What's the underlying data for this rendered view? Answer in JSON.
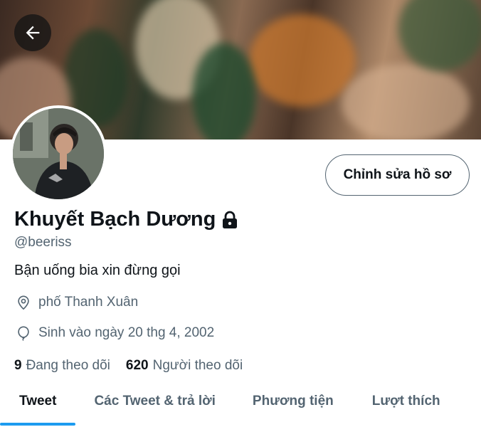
{
  "profile": {
    "display_name": "Khuyết Bạch Dương",
    "handle": "@beeriss",
    "bio": "Bận uống bia xin đừng gọi",
    "location": "phố Thanh Xuân",
    "birthday": "Sinh vào ngày 20 thg 4, 2002",
    "following_count": "9",
    "following_label": "Đang theo dõi",
    "followers_count": "620",
    "followers_label": "Người theo dõi"
  },
  "actions": {
    "edit_profile": "Chỉnh sửa hồ sơ"
  },
  "tabs": [
    {
      "label": "Tweet",
      "active": true
    },
    {
      "label": "Các Tweet & trả lời",
      "active": false
    },
    {
      "label": "Phương tiện",
      "active": false
    },
    {
      "label": "Lượt thích",
      "active": false
    }
  ],
  "icons": {
    "back": "arrow-left-icon",
    "lock": "lock-icon",
    "location": "location-pin-icon",
    "birthday": "balloon-icon"
  },
  "colors": {
    "accent": "#1d9bf0",
    "secondary_text": "#536471",
    "primary_text": "#0f1419"
  }
}
